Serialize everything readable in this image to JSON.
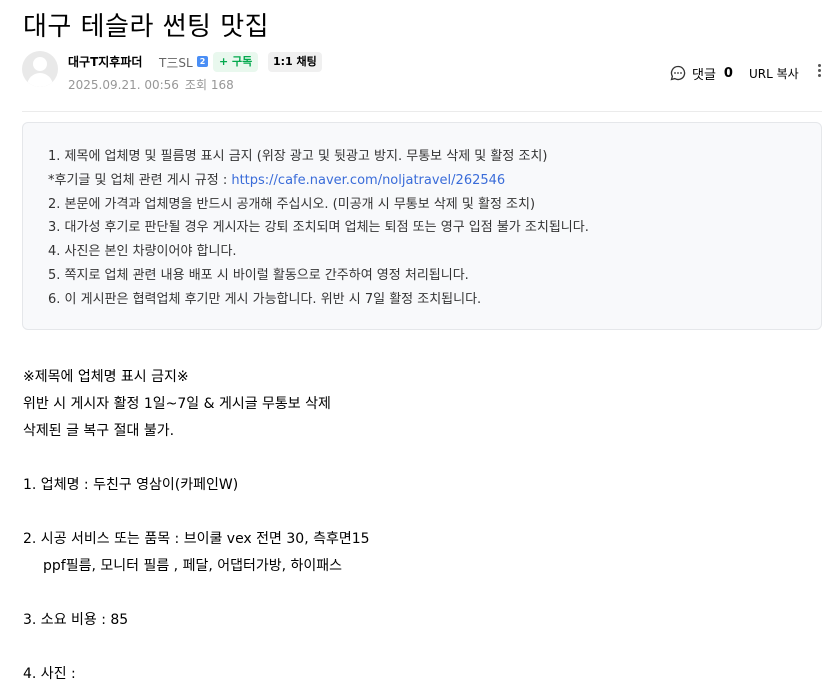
{
  "post": {
    "title": "대구 테슬라 썬팅 맛집"
  },
  "author": {
    "nickname": "대구T지후파더",
    "grade": "T三SL",
    "grade_badge": "2",
    "subscribe_label": "+ 구독",
    "chat_label": "1:1 채팅",
    "date": "2025.09.21. 00:56",
    "views": "조회 168"
  },
  "actions": {
    "comment_label": "댓글",
    "comment_count": "0",
    "url_copy_label": "URL 복사"
  },
  "notice": {
    "line1": "1. 제목에 업체명 및 필름명 표시 금지 (위장 광고 및 뒷광고 방지. 무통보 삭제 및 활정 조치)",
    "line2_prefix": "*후기글 및 업체 관련 게시 규정 : ",
    "line2_link": "https://cafe.naver.com/noljatravel/262546",
    "line3": "2. 본문에 가격과 업체명을 반드시 공개해 주십시오. (미공개 시 무통보 삭제 및 활정 조치)",
    "line4": "3. 대가성 후기로 판단될 경우 게시자는 강퇴 조치되며 업체는 퇴점 또는 영구 입점 불가 조치됩니다.",
    "line5": "4. 사진은 본인 차량이어야 합니다.",
    "line6": "5. 쪽지로 업체 관련 내용 배포 시 바이럴 활동으로 간주하여 영정 처리됩니다.",
    "line7": "6. 이 게시판은 협력업체 후기만 게시 가능합니다. 위반 시 7일 활정 조치됩니다."
  },
  "body": {
    "warn1": "※제목에 업체명 표시 금지※",
    "warn2": "위반 시 게시자 활정 1일~7일 & 게시글 무통보 삭제",
    "warn3": "삭제된 글 복구 절대 불가.",
    "item1": "1. 업체명 :  두친구 영삼이(카페인W)",
    "item2": "2. 시공 서비스 또는 품목 :  브이쿨 vex 전면 30, 측후면15",
    "item2_cont": "ppf필름, 모니터 필름 , 페달, 어댑터가방, 하이패스",
    "item3": "3. 소요 비용 :  85",
    "item4": "4. 사진 :"
  },
  "colors": {
    "link": "#3a6cd9",
    "subscribe_green": "#03a94d",
    "meta_gray": "#979797"
  }
}
